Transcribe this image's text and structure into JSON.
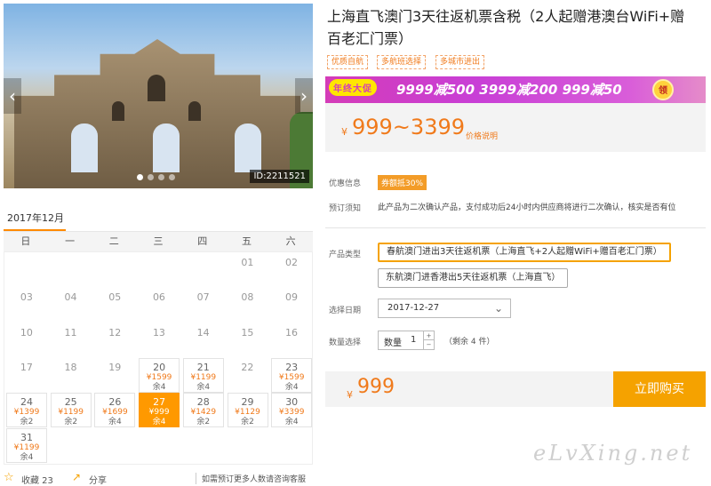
{
  "hero": {
    "image_id": "ID:2211521"
  },
  "calendar": {
    "month": "2017年12月",
    "weekdays": [
      "日",
      "一",
      "二",
      "三",
      "四",
      "五",
      "六"
    ],
    "rows": [
      [
        {
          "d": ""
        },
        {
          "d": ""
        },
        {
          "d": ""
        },
        {
          "d": ""
        },
        {
          "d": ""
        },
        {
          "d": "01"
        },
        {
          "d": "02"
        }
      ],
      [
        {
          "d": "03"
        },
        {
          "d": "04"
        },
        {
          "d": "05"
        },
        {
          "d": "06"
        },
        {
          "d": "07"
        },
        {
          "d": "08"
        },
        {
          "d": "09"
        }
      ],
      [
        {
          "d": "10"
        },
        {
          "d": "11"
        },
        {
          "d": "12"
        },
        {
          "d": "13"
        },
        {
          "d": "14"
        },
        {
          "d": "15"
        },
        {
          "d": "16"
        }
      ],
      [
        {
          "d": "17"
        },
        {
          "d": "18"
        },
        {
          "d": "19"
        },
        {
          "d": "20",
          "p": "¥1599",
          "s": "余4"
        },
        {
          "d": "21",
          "p": "¥1199",
          "s": "余4"
        },
        {
          "d": "22"
        },
        {
          "d": "23",
          "p": "¥1599",
          "s": "余4"
        }
      ],
      [
        {
          "d": "24",
          "p": "¥1399",
          "s": "余2"
        },
        {
          "d": "25",
          "p": "¥1199",
          "s": "余2"
        },
        {
          "d": "26",
          "p": "¥1699",
          "s": "余4"
        },
        {
          "d": "27",
          "p": "¥999",
          "s": "余4",
          "sel": true
        },
        {
          "d": "28",
          "p": "¥1429",
          "s": "余2"
        },
        {
          "d": "29",
          "p": "¥1129",
          "s": "余2"
        },
        {
          "d": "30",
          "p": "¥3399",
          "s": "余4"
        }
      ],
      [
        {
          "d": "31",
          "p": "¥1199",
          "s": "余4"
        },
        {
          "d": ""
        },
        {
          "d": ""
        },
        {
          "d": ""
        },
        {
          "d": ""
        },
        {
          "d": ""
        },
        {
          "d": ""
        }
      ]
    ]
  },
  "footer": {
    "fav": "收藏 23",
    "share": "分享",
    "help": "如需预订更多人数请咨询客服"
  },
  "product": {
    "title": "上海直飞澳门3天往返机票含税（2人起赠港澳台WiFi+赠百老汇门票）",
    "tags": [
      "优质自航",
      "多航班选择",
      "多城市进出"
    ],
    "banner": {
      "badge": "年终大促",
      "text": "9999减500  3999减200  999减50",
      "coin": "领"
    },
    "price": {
      "yen": "¥",
      "range": "999~3399",
      "note": "价格说明"
    }
  },
  "info": {
    "promo_label": "优惠信息",
    "promo_tag": "券额抵30%",
    "notice_label": "预订须知",
    "notice_text": "此产品为二次确认产品，支付成功后24小时内供应商将进行二次确认，核实是否有位"
  },
  "form": {
    "type_label": "产品类型",
    "type_options": [
      "春航澳门进出3天往返机票（上海直飞+2人起赠WiFi+赠百老汇门票）",
      "东航澳门进香港出5天往返机票（上海直飞）"
    ],
    "date_label": "选择日期",
    "date_value": "2017-12-27",
    "chevron": "chevron-down-icon",
    "qty_label": "数量选择",
    "qty_field_label": "数量",
    "qty_value": "1",
    "stock": "（剩余 4 件）"
  },
  "buy": {
    "yen": "¥",
    "price": "999",
    "button": "立即购买"
  },
  "watermark": "eLvXing.net",
  "colors": {
    "accent": "#f5a200",
    "price": "#f07a1b",
    "banner": "#c83fd6"
  }
}
